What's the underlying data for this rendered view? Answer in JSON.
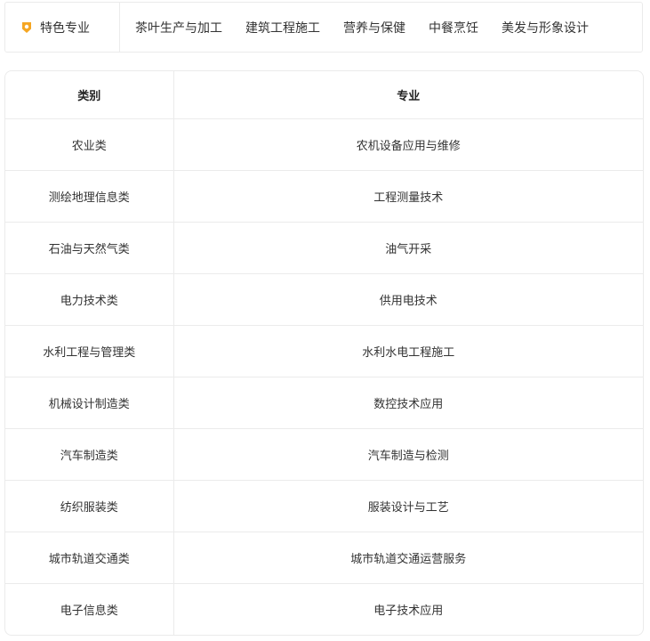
{
  "featured": {
    "label": "特色专业",
    "icon": "badge-icon",
    "accent": "#f5a623"
  },
  "nav": [
    "茶叶生产与加工",
    "建筑工程施工",
    "营养与保健",
    "中餐烹饪",
    "美发与形象设计"
  ],
  "table": {
    "headers": {
      "category": "类别",
      "major": "专业"
    },
    "rows": [
      {
        "category": "农业类",
        "major": "农机设备应用与维修"
      },
      {
        "category": "测绘地理信息类",
        "major": "工程测量技术"
      },
      {
        "category": "石油与天然气类",
        "major": "油气开采"
      },
      {
        "category": "电力技术类",
        "major": "供用电技术"
      },
      {
        "category": "水利工程与管理类",
        "major": "水利水电工程施工"
      },
      {
        "category": "机械设计制造类",
        "major": "数控技术应用"
      },
      {
        "category": "汽车制造类",
        "major": "汽车制造与检测"
      },
      {
        "category": "纺织服装类",
        "major": "服装设计与工艺"
      },
      {
        "category": "城市轨道交通类",
        "major": "城市轨道交通运营服务"
      },
      {
        "category": "电子信息类",
        "major": "电子技术应用"
      }
    ]
  }
}
